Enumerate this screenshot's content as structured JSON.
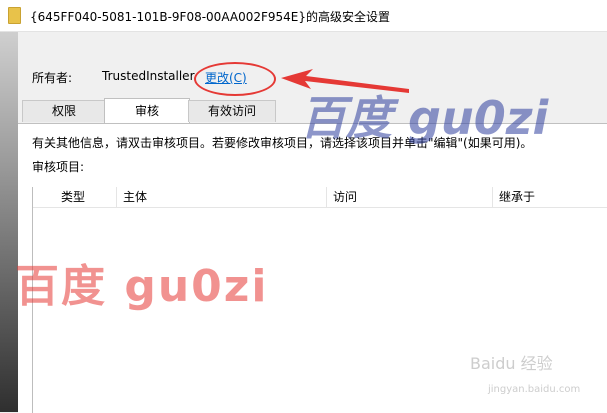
{
  "window": {
    "title": "{645FF040-5081-101B-9F08-00AA002F954E}的高级安全设置"
  },
  "owner": {
    "label": "所有者:",
    "value": "TrustedInstaller",
    "change_link": "更改(C)"
  },
  "tabs": [
    {
      "label": "权限",
      "active": false
    },
    {
      "label": "审核",
      "active": true
    },
    {
      "label": "有效访问",
      "active": false
    }
  ],
  "audit": {
    "info": "有关其他信息，请双击审核项目。若要修改审核项目，请选择该项目并单击\"编辑\"(如果可用)。",
    "entries_label": "审核项目:",
    "columns": [
      "类型",
      "主体",
      "访问",
      "继承于"
    ]
  },
  "watermarks": {
    "red_text": "百度  gu0zi",
    "blue_text": "百度 gu0zi",
    "baidu_logo_text": "Baidu 经验",
    "site": "jingyan.baidu.com"
  },
  "colors": {
    "link": "#0066cc",
    "annotation": "#e53935"
  }
}
